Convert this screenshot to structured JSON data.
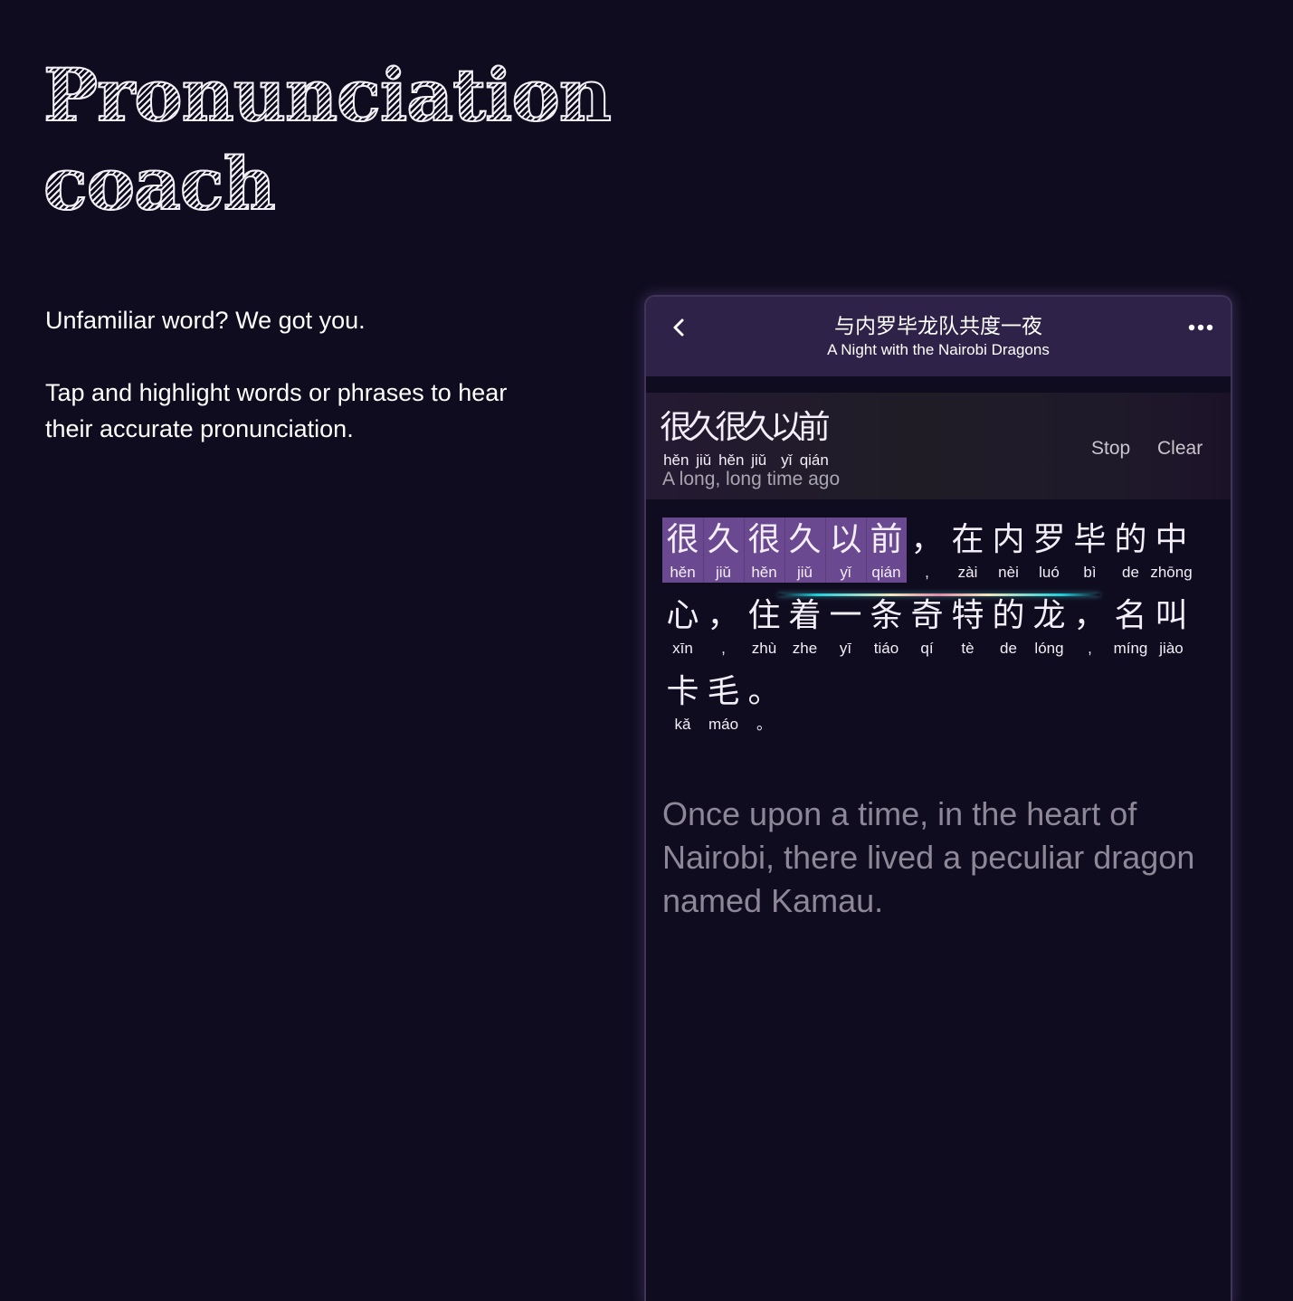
{
  "hero": {
    "title_line1": "Pronunciation",
    "title_line2": "coach",
    "desc1": "Unfamiliar word? We got you.",
    "desc2": "Tap and highlight words or phrases to hear their accurate pronunciation."
  },
  "app": {
    "title_zh": "与内罗毕龙队共度一夜",
    "title_en": "A Night with the Nairobi Dragons",
    "back_icon": "chevron-left-icon",
    "more_icon": "more-horizontal-icon"
  },
  "selection": {
    "chars": [
      {
        "zh": "很",
        "py": "hěn"
      },
      {
        "zh": "久",
        "py": "jiǔ"
      },
      {
        "zh": "很",
        "py": "hěn"
      },
      {
        "zh": "久",
        "py": "jiǔ"
      },
      {
        "zh": "以",
        "py": "yǐ"
      },
      {
        "zh": "前",
        "py": "qián"
      }
    ],
    "translation": "A long, long time ago",
    "stop_label": "Stop",
    "clear_label": "Clear",
    "accent_color": "#b77ee0"
  },
  "reader": {
    "highlight_color": "#6a4990",
    "lines": [
      [
        {
          "zh": "很",
          "py": "hěn",
          "hl": true
        },
        {
          "zh": "久",
          "py": "jiǔ",
          "hl": true
        },
        {
          "zh": "很",
          "py": "hěn",
          "hl": true
        },
        {
          "zh": "久",
          "py": "jiǔ",
          "hl": true
        },
        {
          "zh": "以",
          "py": "yǐ",
          "hl": true
        },
        {
          "zh": "前",
          "py": "qián",
          "hl": true
        },
        {
          "zh": "，",
          "py": ","
        },
        {
          "zh": "在",
          "py": "zài"
        },
        {
          "zh": "内",
          "py": "nèi"
        },
        {
          "zh": "罗",
          "py": "luó"
        },
        {
          "zh": "毕",
          "py": "bì"
        },
        {
          "zh": "的",
          "py": "de"
        },
        {
          "zh": "中",
          "py": "zhōng"
        }
      ],
      [
        {
          "zh": "心",
          "py": "xīn"
        },
        {
          "zh": "，",
          "py": ","
        },
        {
          "zh": "住",
          "py": "zhù"
        },
        {
          "zh": "着",
          "py": "zhe"
        },
        {
          "zh": "一",
          "py": "yī"
        },
        {
          "zh": "条",
          "py": "tiáo"
        },
        {
          "zh": "奇",
          "py": "qí"
        },
        {
          "zh": "特",
          "py": "tè"
        },
        {
          "zh": "的",
          "py": "de"
        },
        {
          "zh": "龙",
          "py": "lóng"
        },
        {
          "zh": "，",
          "py": ","
        },
        {
          "zh": "名",
          "py": "míng"
        },
        {
          "zh": "叫",
          "py": "jiào"
        }
      ],
      [
        {
          "zh": "卡",
          "py": "kǎ"
        },
        {
          "zh": "毛",
          "py": "máo"
        },
        {
          "zh": "。",
          "py": "。"
        }
      ]
    ],
    "translation": "Once upon a time, in the heart of Nairobi, there lived a peculiar dragon named Kamau."
  }
}
